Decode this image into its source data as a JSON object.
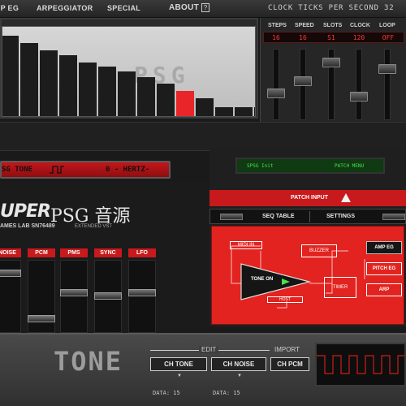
{
  "menu": {
    "items": [
      {
        "label": "AMP EG"
      },
      {
        "label": "ARPEGGIATOR"
      },
      {
        "label": "SPECIAL"
      },
      {
        "label": "ABOUT"
      }
    ],
    "about_help_glyph": "?",
    "clock_label": "CLOCK TICKS PER SECOND 32"
  },
  "bar_display": {
    "watermark": "PSG",
    "bars": [
      0.9,
      0.82,
      0.74,
      0.68,
      0.6,
      0.55,
      0.5,
      0.44,
      0.36,
      0.28,
      0.2,
      0.1,
      0.1,
      0.1
    ],
    "highlight_index": 9,
    "colors": {
      "bar": "#1c1c1c",
      "highlight": "#e8262a"
    }
  },
  "sequencer": {
    "columns": [
      {
        "head": "STEPS",
        "value": "16",
        "level": 0.35
      },
      {
        "head": "SPEED",
        "value": "16",
        "level": 0.55
      },
      {
        "head": "SLOTS",
        "value": "S1",
        "level": 0.85
      },
      {
        "head": "CLOCK",
        "value": "120",
        "level": 0.3
      },
      {
        "head": "LOOP",
        "value": "OFF",
        "level": 0.75
      }
    ]
  },
  "tone_display": {
    "name": "SG TONE",
    "hz": "0 - HERTZ-"
  },
  "logo": {
    "super": "UPER",
    "psg": "PSG 音源",
    "sub": "AMES LAB SN76489",
    "ext": "EXTENDED VST"
  },
  "channels": [
    {
      "label": "NOISE",
      "level": 0.85
    },
    {
      "label": "PCM",
      "level": 0.15
    },
    {
      "label": "PMS",
      "level": 0.55
    },
    {
      "label": "SYNC",
      "level": 0.5
    },
    {
      "label": "LFO",
      "level": 0.55
    }
  ],
  "patch": {
    "lcd_left": "SPSG Init",
    "lcd_right": "PATCH MENU",
    "input_label": "PATCH INPUT",
    "tabs": [
      "SEQ TABLE",
      "SETTINGS"
    ],
    "nodes": {
      "midi_in": "MIDI IN",
      "buzzer": "BUZZER",
      "tone_on": "TONE ON",
      "timer": "TIMER",
      "host": "HOST",
      "amp_eg": "AMP EG",
      "pitch_eg": "PITCH EG",
      "arp": "ARP"
    }
  },
  "bottom": {
    "tone_big": "TONE",
    "edit_label": "EDIT",
    "import_label": "IMPORT",
    "buttons": [
      {
        "label": "CH TONE"
      },
      {
        "label": "CH NOISE"
      },
      {
        "label": "CH PCM"
      }
    ],
    "arrow_glyph": "▼",
    "data_labels": [
      "DATA: 15",
      "DATA: 15"
    ]
  },
  "theme": {
    "accent_red": "#c8191c",
    "lcd_green": "#49e04d"
  }
}
